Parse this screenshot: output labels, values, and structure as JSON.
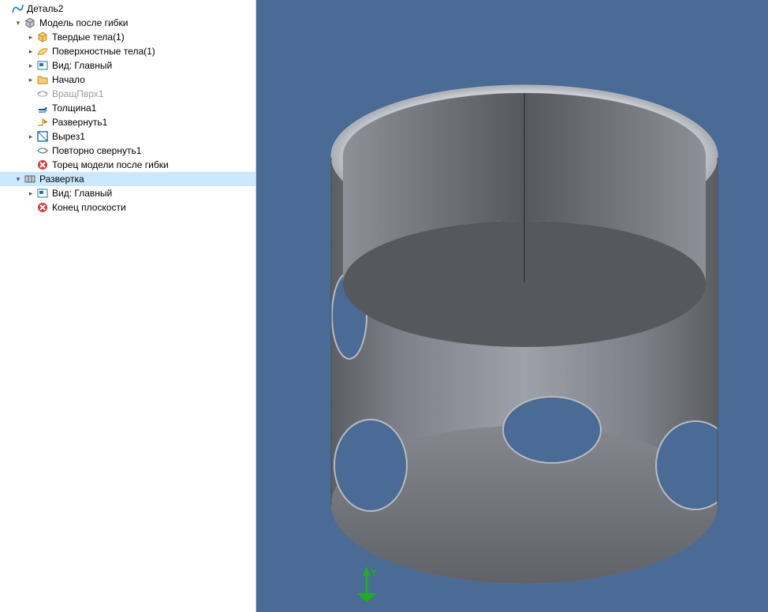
{
  "tree": {
    "root": {
      "label": "Деталь2",
      "icon": "curve-icon"
    },
    "modelAfterBend": {
      "label": "Модель после гибки",
      "icon": "gray-cube-icon",
      "children": {
        "solids": {
          "label": "Твердые тела(1)",
          "icon": "solid-body-icon"
        },
        "surfaces": {
          "label": "Поверхностные тела(1)",
          "icon": "surface-body-icon"
        },
        "view": {
          "label": "Вид: Главный",
          "icon": "view-icon"
        },
        "origin": {
          "label": "Начало",
          "icon": "folder-icon"
        },
        "revolveSurf": {
          "label": "ВращПврх1",
          "icon": "revolve-surf-icon",
          "disabled": true
        },
        "thickness": {
          "label": "Толщина1",
          "icon": "thicken-icon"
        },
        "unfold": {
          "label": "Развернуть1",
          "icon": "unfold-icon"
        },
        "cut": {
          "label": "Вырез1",
          "icon": "cut-icon"
        },
        "refold": {
          "label": "Повторно свернуть1",
          "icon": "refold-icon"
        },
        "endBend": {
          "label": "Торец модели после гибки",
          "icon": "stop-icon"
        }
      }
    },
    "flatPattern": {
      "label": "Развертка",
      "icon": "flat-pattern-icon",
      "children": {
        "view": {
          "label": "Вид: Главный",
          "icon": "view-icon"
        },
        "endPlane": {
          "label": "Конец плоскости",
          "icon": "stop-icon"
        }
      }
    }
  },
  "triad": {
    "label": "Y"
  },
  "colors": {
    "viewportBg": "#4a6b95",
    "selection": "#cce8ff",
    "deepShade": "#595b60",
    "midShade": "#73767d",
    "lightShade": "#8f9299",
    "rim": "#c0c3ca"
  }
}
